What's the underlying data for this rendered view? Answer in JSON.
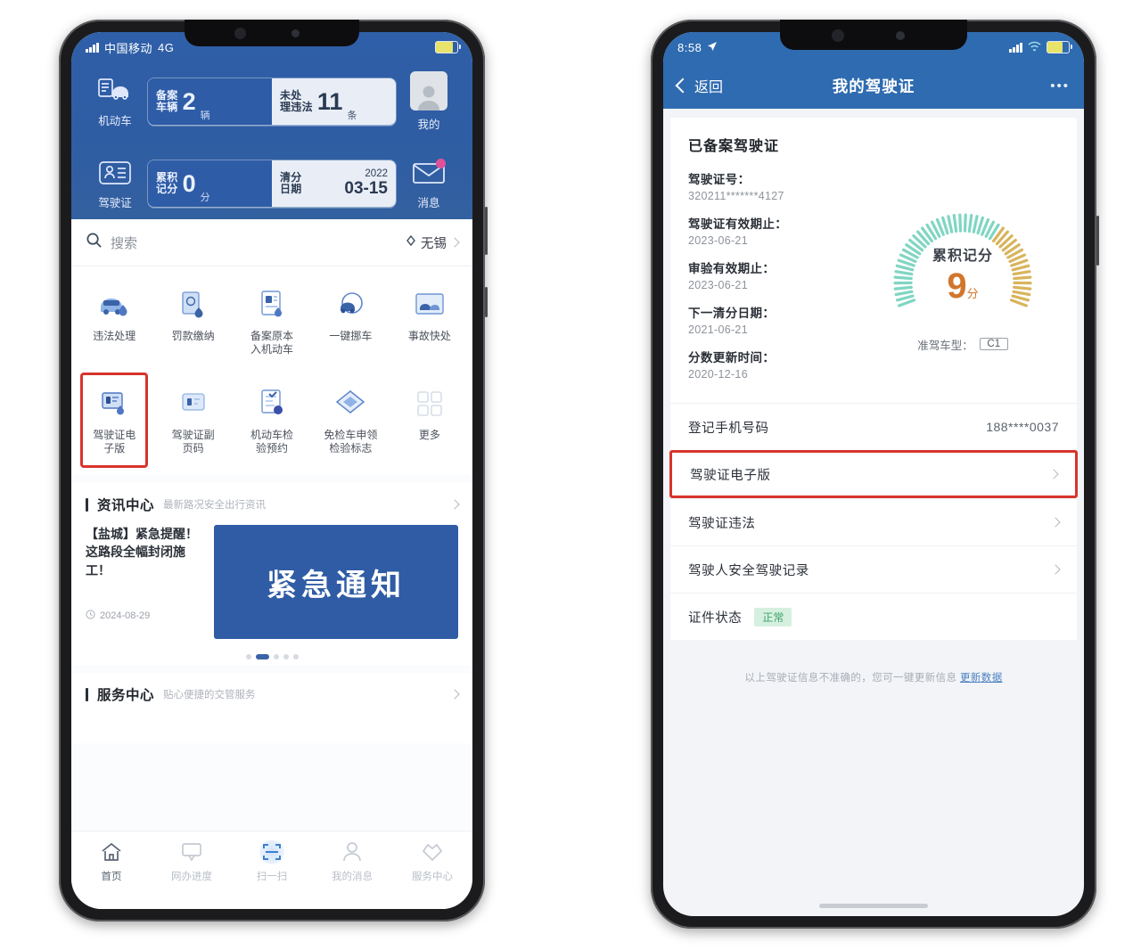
{
  "left_phone": {
    "statusbar": {
      "carrier": "中国移动",
      "network": "4G"
    },
    "hero": {
      "left_items": [
        {
          "label": "机动车",
          "icon": "car-docs-icon"
        },
        {
          "label": "驾驶证",
          "icon": "license-card-icon"
        }
      ],
      "right_items": [
        {
          "label": "我的",
          "icon": "avatar-icon"
        },
        {
          "label": "消息",
          "icon": "mail-icon"
        }
      ],
      "cards": [
        {
          "left_label": "备案\n车辆",
          "left_value": "2",
          "left_unit": "辆",
          "right_label": "未处\n理违法",
          "right_value": "11",
          "right_unit": "条",
          "right_type": "number"
        },
        {
          "left_label": "累积\n记分",
          "left_value": "0",
          "left_unit": "分",
          "right_label": "清分\n日期",
          "right_year": "2022",
          "right_date": "03-15",
          "right_type": "date"
        }
      ]
    },
    "search": {
      "placeholder": "搜索",
      "city": "无锡",
      "icon": "search-icon"
    },
    "grid": [
      [
        {
          "label": "违法处理",
          "icon": "violation-car-icon"
        },
        {
          "label": "罚款缴纳",
          "icon": "payment-doc-icon"
        },
        {
          "label": "备案原本\n入机动车",
          "icon": "record-doc-icon"
        },
        {
          "label": "一键挪车",
          "icon": "move-car-icon"
        },
        {
          "label": "事故快处",
          "icon": "accident-report-icon"
        }
      ],
      [
        {
          "label": "驾驶证电\n子版",
          "icon": "e-license-icon",
          "highlighted": true
        },
        {
          "label": "驾驶证副\n页码",
          "icon": "license-copy-icon"
        },
        {
          "label": "机动车检\n验预约",
          "icon": "inspection-icon"
        },
        {
          "label": "免检车申领\n检验标志",
          "icon": "exempt-mark-icon"
        },
        {
          "label": "更多",
          "icon": "more-grid-icon"
        }
      ]
    ],
    "news_section": {
      "title": "资讯中心",
      "subtitle": "最新路况安全出行资讯",
      "chevron": "chevron-right-icon"
    },
    "news_item": {
      "title": "【盐城】紧急提醒！这路段全幅封闭施工！",
      "date": "2024-08-29",
      "banner_text": "紧急通知",
      "dots": 5,
      "active_dot": 1
    },
    "service_section": {
      "title": "服务中心",
      "subtitle": "贴心便捷的交管服务",
      "chevron": "chevron-right-icon"
    },
    "tabbar": [
      {
        "label": "首页",
        "icon": "home-icon",
        "active": true
      },
      {
        "label": "网办进度",
        "icon": "monitor-icon",
        "active": false
      },
      {
        "label": "扫一扫",
        "icon": "scan-icon",
        "active": false
      },
      {
        "label": "我的消息",
        "icon": "person-message-icon",
        "active": false
      },
      {
        "label": "服务中心",
        "icon": "heart-tag-icon",
        "active": false
      }
    ]
  },
  "right_phone": {
    "statusbar": {
      "time": "8:58",
      "location_icon": "location-arrow-icon"
    },
    "nav": {
      "back_label": "返回",
      "title": "我的驾驶证",
      "more": "•••"
    },
    "card": {
      "heading": "已备案驾驶证",
      "fields": [
        {
          "label": "驾驶证号：",
          "value": "320211*******4127"
        },
        {
          "label": "驾驶证有效期止：",
          "value": "2023-06-21"
        },
        {
          "label": "审验有效期止：",
          "value": "2023-06-21"
        },
        {
          "label": "下一清分日期：",
          "value": "2021-06-21"
        },
        {
          "label": "分数更新时间：",
          "value": "2020-12-16"
        }
      ],
      "gauge": {
        "title": "累积记分",
        "value": "9",
        "unit": "分",
        "license_type_label": "准驾车型：",
        "license_type_value": "C1",
        "color_low": "#7fd6c2",
        "color_high": "#d8b45c"
      }
    },
    "rows": [
      {
        "label": "登记手机号码",
        "value": "188****0037",
        "chevron": false,
        "highlighted": false
      },
      {
        "label": "驾驶证电子版",
        "value": "",
        "chevron": true,
        "highlighted": true
      },
      {
        "label": "驾驶证违法",
        "value": "",
        "chevron": true,
        "highlighted": false
      },
      {
        "label": "驾驶人安全驾驶记录",
        "value": "",
        "chevron": true,
        "highlighted": false
      },
      {
        "label": "证件状态",
        "badge": "正常",
        "chevron": false,
        "highlighted": false
      }
    ],
    "footer": {
      "text": "以上驾驶证信息不准确的，您可一键更新信息",
      "link": "更新数据"
    }
  },
  "colors": {
    "brand_blue": "#2f5da4",
    "nav_blue": "#2f6bb0",
    "highlight_red": "#d8342c",
    "score_orange": "#d2762c"
  }
}
